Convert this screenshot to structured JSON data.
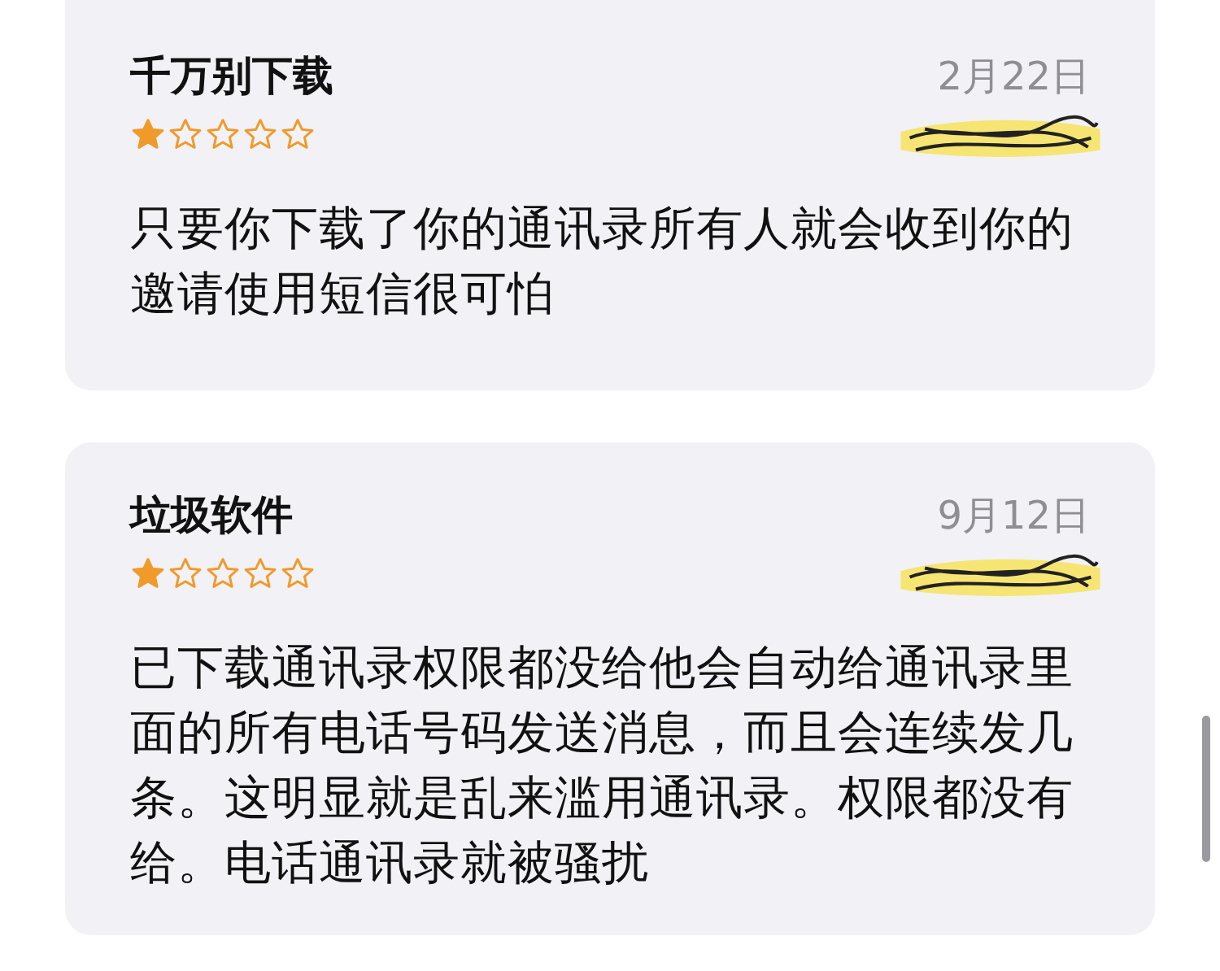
{
  "reviews": [
    {
      "title": "千万别下载",
      "date": "2月22日",
      "stars": 1,
      "author_redacted": true,
      "body": "只要你下载了你的通讯录所有人就会收到你的邀请使用短信很可怕"
    },
    {
      "title": "垃圾软件",
      "date": "9月12日",
      "stars": 1,
      "author_redacted": true,
      "body": "已下载通讯录权限都没给他会自动给通讯录里面的所有电话号码发送消息，而且会连续发几条。这明显就是乱来滥用通讯录。权限都没有给。电话通讯录就被骚扰"
    }
  ]
}
